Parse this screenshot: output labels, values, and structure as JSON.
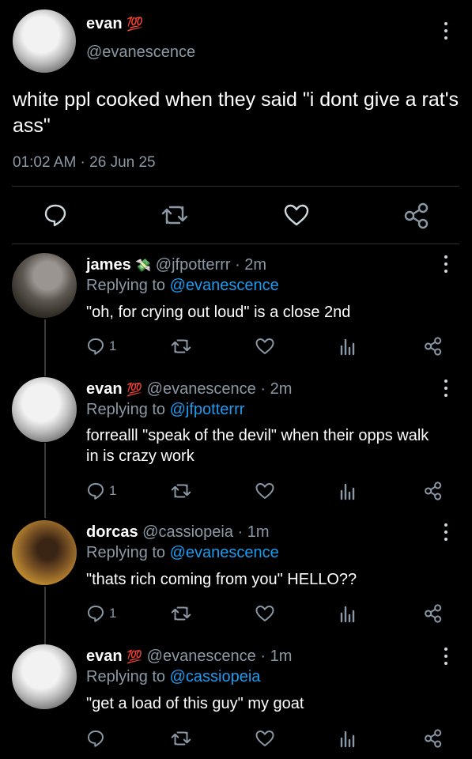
{
  "main_tweet": {
    "display_name": "evan",
    "badge": "💯",
    "handle": "@evanescence",
    "text": "white ppl cooked when they said \"i dont give a rat's ass\"",
    "timestamp": "01:02 AM · 26 Jun 25"
  },
  "replies": [
    {
      "display_name": "james",
      "badge": "💸",
      "handle": "@jfpotterrr",
      "time": "· 2m",
      "replying_prefix": "Replying to ",
      "replying_to": "@evanescence",
      "text": "\"oh, for crying out loud\" is a close 2nd",
      "reply_count": "1"
    },
    {
      "display_name": "evan",
      "badge": "💯",
      "handle": "@evanescence",
      "time": "· 2m",
      "replying_prefix": "Replying to ",
      "replying_to": "@jfpotterrr",
      "text": "forrealll \"speak of the devil\" when their opps walk in is crazy work",
      "reply_count": "1"
    },
    {
      "display_name": "dorcas",
      "badge": "",
      "handle": "@cassiopeia",
      "time": "· 1m",
      "replying_prefix": "Replying to ",
      "replying_to": "@evanescence",
      "text": "\"thats rich coming from you\" HELLO??",
      "reply_count": "1"
    },
    {
      "display_name": "evan",
      "badge": "💯",
      "handle": "@evanescence",
      "time": "· 1m",
      "replying_prefix": "Replying to ",
      "replying_to": "@cassiopeia",
      "text": "\"get a load of this guy\" my goat",
      "reply_count": ""
    }
  ],
  "icons": {
    "reply": "reply-icon",
    "retweet": "retweet-icon",
    "like": "heart-icon",
    "views": "views-icon",
    "share": "share-icon",
    "more": "more-icon"
  },
  "colors": {
    "background": "#000000",
    "text": "#ffffff",
    "muted": "#8b98a5",
    "link": "#1d9bf0"
  }
}
